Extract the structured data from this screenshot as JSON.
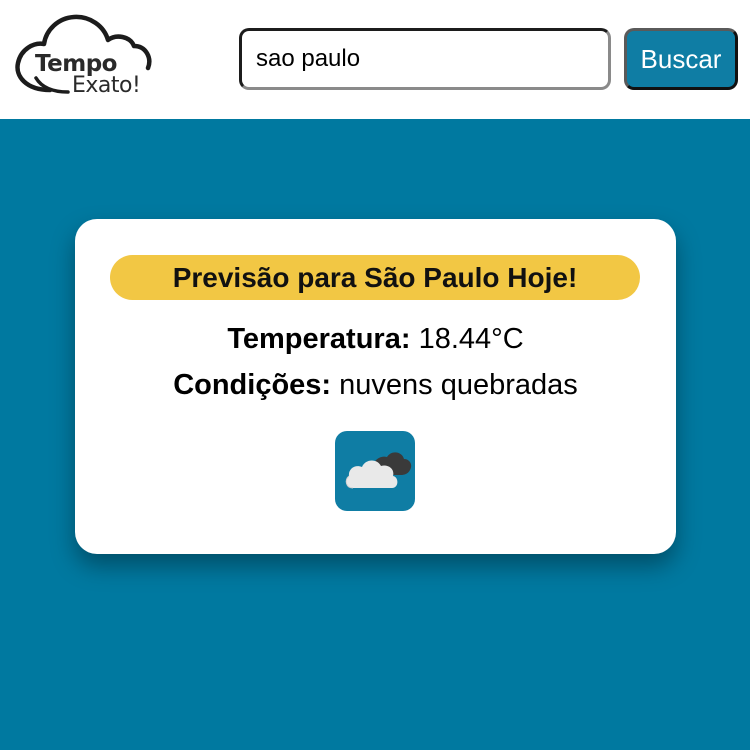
{
  "header": {
    "logo": {
      "word1": "Tempo",
      "word2": "Exato!"
    },
    "search": {
      "value": "sao paulo"
    },
    "button_label": "Buscar"
  },
  "card": {
    "title": "Previsão para São Paulo Hoje!",
    "temperature_label": "Temperatura:",
    "temperature_value": "18.44°C",
    "conditions_label": "Condições:",
    "conditions_value": "nuvens quebradas",
    "icon": "broken-clouds-icon"
  },
  "colors": {
    "background": "#0079a0",
    "button": "#0f7da4",
    "title_pill": "#f2c744",
    "card": "#ffffff"
  }
}
